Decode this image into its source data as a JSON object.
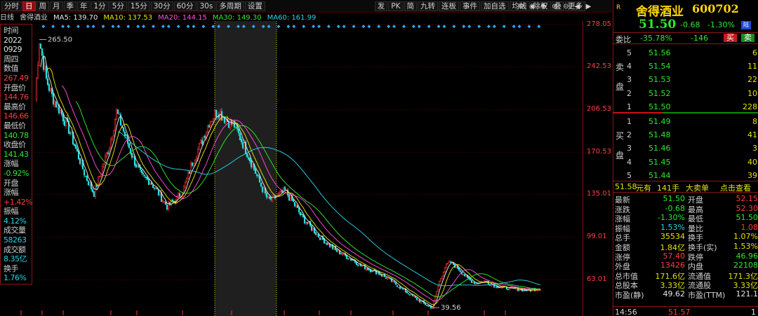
{
  "toolbar": {
    "left_buttons": [
      "分时",
      "日",
      "周",
      "月",
      "季",
      "年",
      "1分",
      "5分",
      "15分",
      "30分",
      "60分",
      "30s",
      "多周期",
      "设置"
    ],
    "active_index": 1,
    "right_buttons": [
      "发",
      "PK",
      "简",
      "九转",
      "连板",
      "事件",
      "加自选",
      "均线",
      "除权",
      "叠",
      "更多"
    ],
    "icons": [
      "settings-icon",
      "eye-icon",
      "cursor-icon",
      "zoom-in-icon",
      "zoom-out-icon",
      "arrow-left-icon",
      "arrow-right-icon"
    ]
  },
  "ma_legend": {
    "period_label": "日线",
    "stock_name": "舍得酒业",
    "items": [
      {
        "label": "MA5: 139.70",
        "color": "#e6e6e6"
      },
      {
        "label": "MA10: 137.53",
        "color": "#e3e300"
      },
      {
        "label": "MA20: 144.15",
        "color": "#ff4fd8"
      },
      {
        "label": "MA30: 149.30",
        "color": "#2ee82e"
      },
      {
        "label": "MA60: 161.99",
        "color": "#27d3e6"
      }
    ]
  },
  "info_panel": [
    {
      "text": "时间",
      "type": "lbl"
    },
    {
      "text": "2022",
      "type": "val"
    },
    {
      "text": "0929",
      "type": "val"
    },
    {
      "text": "周四",
      "type": "lbl"
    },
    {
      "text": "数值",
      "type": "lbl"
    },
    {
      "text": "267.49",
      "type": "red"
    },
    {
      "text": "开盘价",
      "type": "lbl"
    },
    {
      "text": "144.76",
      "type": "red"
    },
    {
      "text": "最高价",
      "type": "lbl"
    },
    {
      "text": "146.66",
      "type": "red"
    },
    {
      "text": "最低价",
      "type": "lbl"
    },
    {
      "text": "140.78",
      "type": "green"
    },
    {
      "text": "收盘价",
      "type": "lbl"
    },
    {
      "text": "141.43",
      "type": "green"
    },
    {
      "text": "涨幅",
      "type": "lbl"
    },
    {
      "text": "-0.92%",
      "type": "green"
    },
    {
      "text": "开盘",
      "type": "lbl"
    },
    {
      "text": "涨幅",
      "type": "lbl"
    },
    {
      "text": "+1.42%",
      "type": "red"
    },
    {
      "text": "振幅",
      "type": "lbl"
    },
    {
      "text": "4.12%",
      "type": "cyan"
    },
    {
      "text": "成交量",
      "type": "lbl"
    },
    {
      "text": "58263",
      "type": "cyan"
    },
    {
      "text": "成交额",
      "type": "lbl"
    },
    {
      "text": "8.35亿",
      "type": "cyan"
    },
    {
      "text": "换手",
      "type": "lbl"
    },
    {
      "text": "1.76%",
      "type": "cyan"
    }
  ],
  "chart_data": {
    "type": "candlestick",
    "y_ticks": [
      "278.05",
      "242.53",
      "206.53",
      "170.53",
      "135.01",
      "99.01",
      "63.01"
    ],
    "ylim": [
      39,
      280
    ],
    "annotations": {
      "high": "265.50",
      "low": "39.56"
    },
    "keypoints": [
      [
        0,
        215
      ],
      [
        3,
        265.5
      ],
      [
        8,
        232
      ],
      [
        12,
        218
      ],
      [
        18,
        205
      ],
      [
        24,
        190
      ],
      [
        30,
        170
      ],
      [
        36,
        150
      ],
      [
        42,
        136
      ],
      [
        48,
        158
      ],
      [
        53,
        176
      ],
      [
        58,
        205
      ],
      [
        64,
        185
      ],
      [
        70,
        165
      ],
      [
        76,
        150
      ],
      [
        82,
        146
      ],
      [
        88,
        136
      ],
      [
        94,
        125
      ],
      [
        100,
        130
      ],
      [
        106,
        140
      ],
      [
        112,
        162
      ],
      [
        118,
        178
      ],
      [
        124,
        196
      ],
      [
        130,
        206
      ],
      [
        136,
        198
      ],
      [
        142,
        193
      ],
      [
        148,
        178
      ],
      [
        154,
        162
      ],
      [
        160,
        145
      ],
      [
        166,
        130
      ],
      [
        172,
        133
      ],
      [
        178,
        138
      ],
      [
        184,
        128
      ],
      [
        190,
        116
      ],
      [
        196,
        108
      ],
      [
        202,
        100
      ],
      [
        208,
        94
      ],
      [
        214,
        88
      ],
      [
        220,
        84
      ],
      [
        226,
        80
      ],
      [
        232,
        75
      ],
      [
        238,
        72
      ],
      [
        244,
        69
      ],
      [
        250,
        65
      ],
      [
        256,
        60
      ],
      [
        262,
        55
      ],
      [
        268,
        50
      ],
      [
        274,
        45
      ],
      [
        280,
        41
      ],
      [
        283,
        39.56
      ],
      [
        287,
        58
      ],
      [
        292,
        74
      ],
      [
        296,
        78
      ],
      [
        302,
        72
      ],
      [
        308,
        64
      ],
      [
        314,
        60
      ],
      [
        320,
        62
      ],
      [
        328,
        58
      ],
      [
        336,
        56
      ],
      [
        344,
        55
      ],
      [
        352,
        54
      ],
      [
        356,
        55
      ],
      [
        360,
        56
      ]
    ]
  },
  "right_panel": {
    "r_badge": "R",
    "stock_name": "舍得酒业",
    "stock_code": "600702",
    "price": "51.50",
    "change": "-0.68",
    "change_pct": "-1.30%",
    "market_badge": "陆",
    "webi_label": "委比",
    "webi_value": "-35.78%",
    "webi_diff": "-146",
    "buy_btn": "买",
    "sell_btn": "卖",
    "sell_label": "卖盘",
    "buy_label": "买盘",
    "sell_levels": [
      {
        "lv": "5",
        "price": "51.56",
        "vol": "6"
      },
      {
        "lv": "4",
        "price": "51.54",
        "vol": "11"
      },
      {
        "lv": "3",
        "price": "51.53",
        "vol": "22"
      },
      {
        "lv": "2",
        "price": "51.52",
        "vol": "10"
      },
      {
        "lv": "1",
        "price": "51.50",
        "vol": "228"
      }
    ],
    "buy_levels": [
      {
        "lv": "1",
        "price": "51.49",
        "vol": "8"
      },
      {
        "lv": "2",
        "price": "51.48",
        "vol": "41"
      },
      {
        "lv": "3",
        "price": "51.46",
        "vol": "3"
      },
      {
        "lv": "4",
        "price": "51.45",
        "vol": "40"
      },
      {
        "lv": "5",
        "price": "51.44",
        "vol": "39"
      }
    ],
    "big_trade": {
      "price": "51.58",
      "unit": "元有",
      "count": "141手",
      "label": "大卖单",
      "link": "点击查看"
    },
    "stats_left": [
      {
        "k": "最新",
        "v": "51.50",
        "c": "green"
      },
      {
        "k": "涨跌",
        "v": "-0.68",
        "c": "green"
      },
      {
        "k": "涨幅",
        "v": "-1.30%",
        "c": "green"
      },
      {
        "k": "振幅",
        "v": "1.53%",
        "c": "cyan"
      },
      {
        "k": "总手",
        "v": "35534",
        "c": "yellow"
      },
      {
        "k": "金额",
        "v": "1.84亿",
        "c": "yellow"
      },
      {
        "k": "涨停",
        "v": "57.40",
        "c": "red"
      },
      {
        "k": "外盘",
        "v": "13426",
        "c": "red"
      },
      {
        "k": "总市值",
        "v": "171.6亿",
        "c": "yellow"
      },
      {
        "k": "总股本",
        "v": "3.33亿",
        "c": "yellow"
      },
      {
        "k": "市盈(静)",
        "v": "49.62",
        "c": "white"
      }
    ],
    "stats_right": [
      {
        "k": "开盘",
        "v": "52.15",
        "c": "red"
      },
      {
        "k": "最高",
        "v": "52.30",
        "c": "red"
      },
      {
        "k": "最低",
        "v": "51.50",
        "c": "green"
      },
      {
        "k": "量比",
        "v": "1.08",
        "c": "red"
      },
      {
        "k": "换手",
        "v": "1.07%",
        "c": "yellow"
      },
      {
        "k": "换手(实)",
        "v": "1.53%",
        "c": "yellow"
      },
      {
        "k": "跌停",
        "v": "46.96",
        "c": "green"
      },
      {
        "k": "内盘",
        "v": "22108",
        "c": "green"
      },
      {
        "k": "流通值",
        "v": "171.3亿",
        "c": "yellow"
      },
      {
        "k": "流通股",
        "v": "3.33亿",
        "c": "yellow"
      },
      {
        "k": "市盈(TTM)",
        "v": "121.1",
        "c": "white"
      }
    ],
    "tick": {
      "time": "14:56",
      "price": "51.57",
      "vol": "1"
    }
  }
}
